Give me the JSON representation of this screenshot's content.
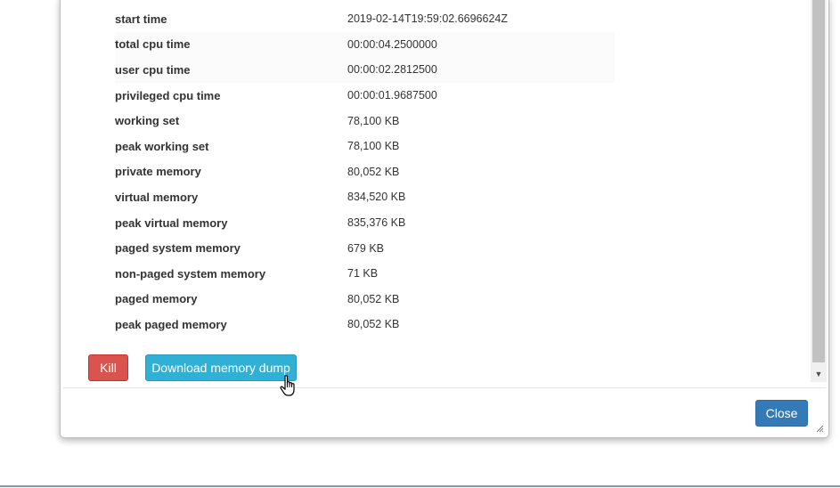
{
  "process_details": {
    "rows": [
      {
        "label": "start time",
        "value": "2019-02-14T19:59:02.6696624Z"
      },
      {
        "label": "total cpu time",
        "value": "00:00:04.2500000"
      },
      {
        "label": "user cpu time",
        "value": "00:00:02.2812500"
      },
      {
        "label": "privileged cpu time",
        "value": "00:00:01.9687500"
      },
      {
        "label": "working set",
        "value": "78,100 KB"
      },
      {
        "label": "peak working set",
        "value": "78,100 KB"
      },
      {
        "label": "private memory",
        "value": "80,052 KB"
      },
      {
        "label": "virtual memory",
        "value": "834,520 KB"
      },
      {
        "label": "peak virtual memory",
        "value": "835,376 KB"
      },
      {
        "label": "paged system memory",
        "value": "679 KB"
      },
      {
        "label": "non-paged system memory",
        "value": "71 KB"
      },
      {
        "label": "paged memory",
        "value": "80,052 KB"
      },
      {
        "label": "peak paged memory",
        "value": "80,052 KB"
      }
    ]
  },
  "actions": {
    "kill_label": "Kill",
    "download_dump_label": "Download memory dump"
  },
  "footer": {
    "close_label": "Close"
  },
  "colors": {
    "danger": "#d9534f",
    "info": "#31b0d5",
    "primary": "#337ab7"
  },
  "icons": {
    "scroll_down": "chevron-down-icon",
    "resize": "resize-grip-icon",
    "cursor": "hand-pointer-cursor"
  }
}
